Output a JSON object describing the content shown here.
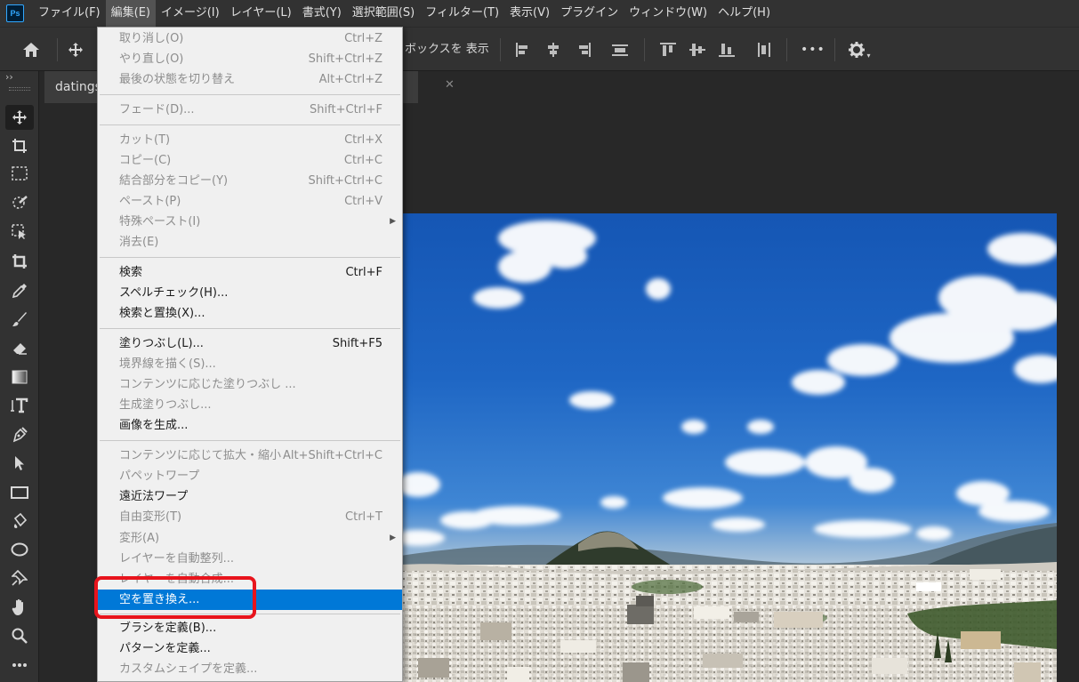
{
  "app": {
    "logo_text": "Ps",
    "accent": "#31a8ff"
  },
  "menubar": {
    "items": [
      "ファイル(F)",
      "編集(E)",
      "イメージ(I)",
      "レイヤー(L)",
      "書式(Y)",
      "選択範囲(S)",
      "フィルター(T)",
      "表示(V)",
      "プラグイン",
      "ウィンドウ(W)",
      "ヘルプ(H)"
    ],
    "active": "編集(E)"
  },
  "options_bar": {
    "show_box_label": "ボックスを 表示",
    "more_label": "•••"
  },
  "document": {
    "tab_title": "datings"
  },
  "edit_menu": {
    "items": [
      {
        "label": "取り消し(O)",
        "shortcut": "Ctrl+Z",
        "disabled": true
      },
      {
        "label": "やり直し(O)",
        "shortcut": "Shift+Ctrl+Z",
        "disabled": true
      },
      {
        "label": "最後の状態を切り替え",
        "shortcut": "Alt+Ctrl+Z",
        "disabled": true
      },
      {
        "label": "フェード(D)...",
        "shortcut": "Shift+Ctrl+F",
        "disabled": true
      },
      {
        "label": "カット(T)",
        "shortcut": "Ctrl+X",
        "disabled": true
      },
      {
        "label": "コピー(C)",
        "shortcut": "Ctrl+C",
        "disabled": true
      },
      {
        "label": "結合部分をコピー(Y)",
        "shortcut": "Shift+Ctrl+C",
        "disabled": true
      },
      {
        "label": "ペースト(P)",
        "shortcut": "Ctrl+V",
        "disabled": true
      },
      {
        "label": "特殊ペースト(I)",
        "shortcut": "",
        "disabled": true,
        "submenu": true
      },
      {
        "label": "消去(E)",
        "shortcut": "",
        "disabled": true
      },
      {
        "label": "検索",
        "shortcut": "Ctrl+F",
        "disabled": false
      },
      {
        "label": "スペルチェック(H)...",
        "shortcut": "",
        "disabled": false
      },
      {
        "label": "検索と置換(X)...",
        "shortcut": "",
        "disabled": false
      },
      {
        "label": "塗りつぶし(L)...",
        "shortcut": "Shift+F5",
        "disabled": false
      },
      {
        "label": "境界線を描く(S)...",
        "shortcut": "",
        "disabled": true
      },
      {
        "label": "コンテンツに応じた塗りつぶし ...",
        "shortcut": "",
        "disabled": true
      },
      {
        "label": "生成塗りつぶし...",
        "shortcut": "",
        "disabled": true
      },
      {
        "label": "画像を生成...",
        "shortcut": "",
        "disabled": false
      },
      {
        "label": "コンテンツに応じて拡大・縮小",
        "shortcut": "Alt+Shift+Ctrl+C",
        "disabled": true
      },
      {
        "label": "パペットワープ",
        "shortcut": "",
        "disabled": true
      },
      {
        "label": "遠近法ワープ",
        "shortcut": "",
        "disabled": false
      },
      {
        "label": "自由変形(T)",
        "shortcut": "Ctrl+T",
        "disabled": true
      },
      {
        "label": "変形(A)",
        "shortcut": "",
        "disabled": true,
        "submenu": true
      },
      {
        "label": "レイヤーを自動整列...",
        "shortcut": "",
        "disabled": true
      },
      {
        "label": "レイヤーを自動合成...",
        "shortcut": "",
        "disabled": true
      },
      {
        "label": "空を置き換え...",
        "shortcut": "",
        "disabled": false,
        "highlighted": true
      },
      {
        "label": "ブラシを定義(B)...",
        "shortcut": "",
        "disabled": false
      },
      {
        "label": "パターンを定義...",
        "shortcut": "",
        "disabled": false
      },
      {
        "label": "カスタムシェイプを定義...",
        "shortcut": "",
        "disabled": true
      }
    ]
  },
  "colors": {
    "highlight": "#0078d7",
    "annotation": "#e8141c",
    "panel": "#323232"
  }
}
